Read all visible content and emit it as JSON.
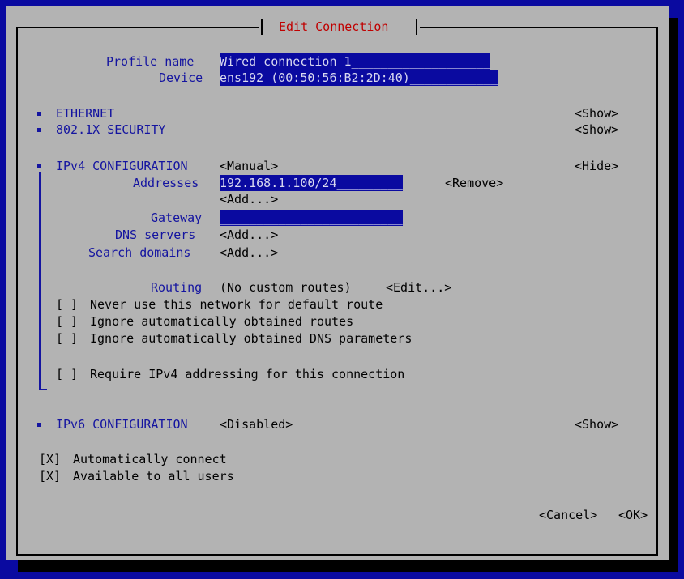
{
  "title": "Edit Connection",
  "profile": {
    "name_label": "Profile name",
    "name_value": "Wired connection 1___________________",
    "device_label": "Device",
    "device_value": "ens192 (00:50:56:B2:2D:40)____________"
  },
  "sections": {
    "ethernet": {
      "label": "ETHERNET",
      "toggle": "<Show>"
    },
    "security": {
      "label": "802.1X SECURITY",
      "toggle": "<Show>"
    },
    "ipv4": {
      "label": "IPv4 CONFIGURATION",
      "mode": "<Manual>",
      "toggle": "<Hide>"
    },
    "ipv6": {
      "label": "IPv6 CONFIGURATION",
      "mode": "<Disabled>",
      "toggle": "<Show>"
    }
  },
  "ipv4": {
    "addresses_label": "Addresses",
    "address_value": "192.168.1.100/24_________",
    "remove": "<Remove>",
    "add_address": "<Add...>",
    "gateway_label": "Gateway",
    "gateway_value": "_________________________",
    "dns_label": "DNS servers",
    "dns_add": "<Add...>",
    "search_label": "Search domains",
    "search_add": "<Add...>",
    "routing_label": "Routing",
    "routing_value": "(No custom routes)",
    "routing_edit": "<Edit...>",
    "checkboxes": [
      {
        "mark": "[ ]",
        "label": "Never use this network for default route"
      },
      {
        "mark": "[ ]",
        "label": "Ignore automatically obtained routes"
      },
      {
        "mark": "[ ]",
        "label": "Ignore automatically obtained DNS parameters"
      },
      {
        "mark": "[ ]",
        "label": "Require IPv4 addressing for this connection"
      }
    ]
  },
  "options": [
    {
      "mark": "[X]",
      "label": "Automatically connect"
    },
    {
      "mark": "[X]",
      "label": "Available to all users"
    }
  ],
  "buttons": {
    "cancel": "<Cancel>",
    "ok": "<OK>"
  }
}
